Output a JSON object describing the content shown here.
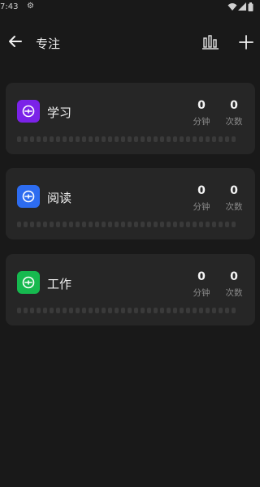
{
  "status_bar": {
    "time": "7:43",
    "gear_icon": "gear-icon"
  },
  "header": {
    "title": "专注",
    "back_icon": "arrow-left-icon",
    "stats_icon": "bar-chart-icon",
    "add_icon": "plus-icon"
  },
  "colors": {
    "background": "#191919",
    "card": "#262626",
    "dot": "#3a3a3a"
  },
  "cards": [
    {
      "name": "学习",
      "icon": "clock-target-icon",
      "color": "#7b22e8",
      "minutes": "0",
      "minutes_label": "分钟",
      "count": "0",
      "count_label": "次数"
    },
    {
      "name": "阅读",
      "icon": "clock-target-icon",
      "color": "#2d6cf0",
      "minutes": "0",
      "minutes_label": "分钟",
      "count": "0",
      "count_label": "次数"
    },
    {
      "name": "工作",
      "icon": "clock-target-icon",
      "color": "#16b94f",
      "minutes": "0",
      "minutes_label": "分钟",
      "count": "0",
      "count_label": "次数"
    }
  ],
  "history_dots_per_card": 34
}
